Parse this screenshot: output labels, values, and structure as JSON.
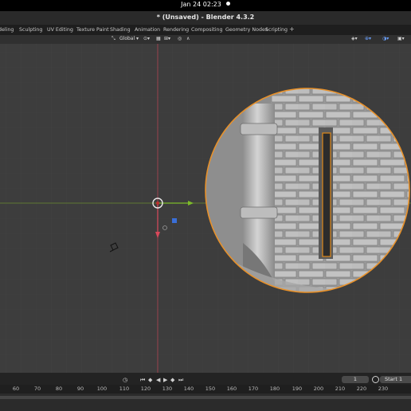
{
  "system": {
    "clock": "Jan 24  02:23"
  },
  "window": {
    "title": "* (Unsaved) - Blender 4.3.2"
  },
  "workspace_tabs": [
    "deling",
    "Sculpting",
    "UV Editing",
    "Texture Paint",
    "Shading",
    "Animation",
    "Rendering",
    "Compositing",
    "Geometry Nodes",
    "Scripting"
  ],
  "add_tab": "+",
  "viewport_header": {
    "orientation": "Global"
  },
  "timeline": {
    "current_frame": "1",
    "start_label": "Start",
    "start_value": "1",
    "ruler": [
      "60",
      "70",
      "80",
      "90",
      "100",
      "110",
      "120",
      "130",
      "140",
      "150",
      "160",
      "170",
      "180",
      "190",
      "200",
      "210",
      "220",
      "230"
    ]
  }
}
